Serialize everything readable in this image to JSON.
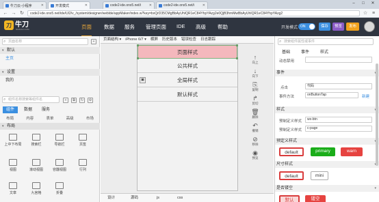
{
  "browser": {
    "tabs": [
      {
        "label": "牛刀云-小程序",
        "active": false
      },
      {
        "label": "开发模式",
        "active": true
      },
      {
        "label": "code2-ide.onx5.net/i",
        "active": false
      },
      {
        "label": "code2-ide.onx5.net/i",
        "active": false
      }
    ],
    "address": "code2-ide.onx5.net/ide/UI2/v_/system/designer/weblde/appMaker/index.w?key=bxQrD35CMgBbAyUhIQR1eC84YhpYAzg2e0QjB3hmMwBbAyUhIQR1eC84YhpYAzg2"
  },
  "header": {
    "logo_text": "牛刀",
    "logo_mark": "刀",
    "logo_sub": "NIUDAO.COM",
    "nav": [
      "页面",
      "数据",
      "服务",
      "管理页面",
      "IDE",
      "高级",
      "帮助"
    ],
    "dev_mode_label": "开发模式",
    "toggle_label": "ON",
    "save_label": "保存",
    "preview_label": "预览",
    "publish_label": "发布",
    "colors": {
      "bg": "#2f3540",
      "accent": "#e9a73a",
      "save": "#3b8fe0",
      "preview": "#8b5cc7",
      "publish": "#f0a21c"
    }
  },
  "left": {
    "search_placeholder": "页面名称",
    "section_default": "默认",
    "page_home": "主页",
    "section_settings": "设置",
    "page_my": "我的",
    "component_search_placeholder": "组件名称搜索等组件名",
    "tabs": [
      "组件",
      "数据",
      "服务"
    ],
    "categories": [
      "布局",
      "内容",
      "表单",
      "高级",
      "市场"
    ],
    "section_layout": "布局",
    "components": [
      "上中下布局",
      "搜索栏",
      "导航栏",
      "页签",
      "视图",
      "滚动视图",
      "容器视图",
      "行列",
      "文章",
      "九宫格",
      "折叠"
    ]
  },
  "canvas": {
    "toolbar": [
      "页面结构 ▾",
      "iPhone 6/7 ▾",
      "横屏",
      "历史版本",
      "错误检查",
      "日志跟踪"
    ],
    "items": [
      "页面样式",
      "公共样式",
      "全局样式",
      "默认样式"
    ],
    "selected_index": 0,
    "tools": [
      "向上",
      "向下",
      "复制",
      "剪切",
      "删除",
      "撤销",
      "移除",
      "预览"
    ],
    "bottom_tabs": [
      "设计",
      "源码",
      "js",
      "css"
    ]
  },
  "right": {
    "search_placeholder": "搜索组件属性或事件",
    "tabs": [
      "基础",
      "事件",
      "样式"
    ],
    "anim_label": "动态禁用",
    "events_header": "事件",
    "click_label": "点击",
    "click_value": "代码",
    "method_label": "事件方法",
    "method_value": "onButtonTap",
    "new_label": "新建",
    "style_header": "样式",
    "class1_label": "预制定义样式",
    "class1_value": "wx-btn",
    "class2_label": "预制定义样式",
    "class2_value": "c-page",
    "preset_header": "预定义样式",
    "presets": [
      "default",
      "primary",
      "warn"
    ],
    "size_header": "尺寸样式",
    "sizes": [
      "default",
      "mini"
    ],
    "other_header": "是否镂空",
    "bottom_btns": [
      "默认",
      "镂空"
    ]
  }
}
